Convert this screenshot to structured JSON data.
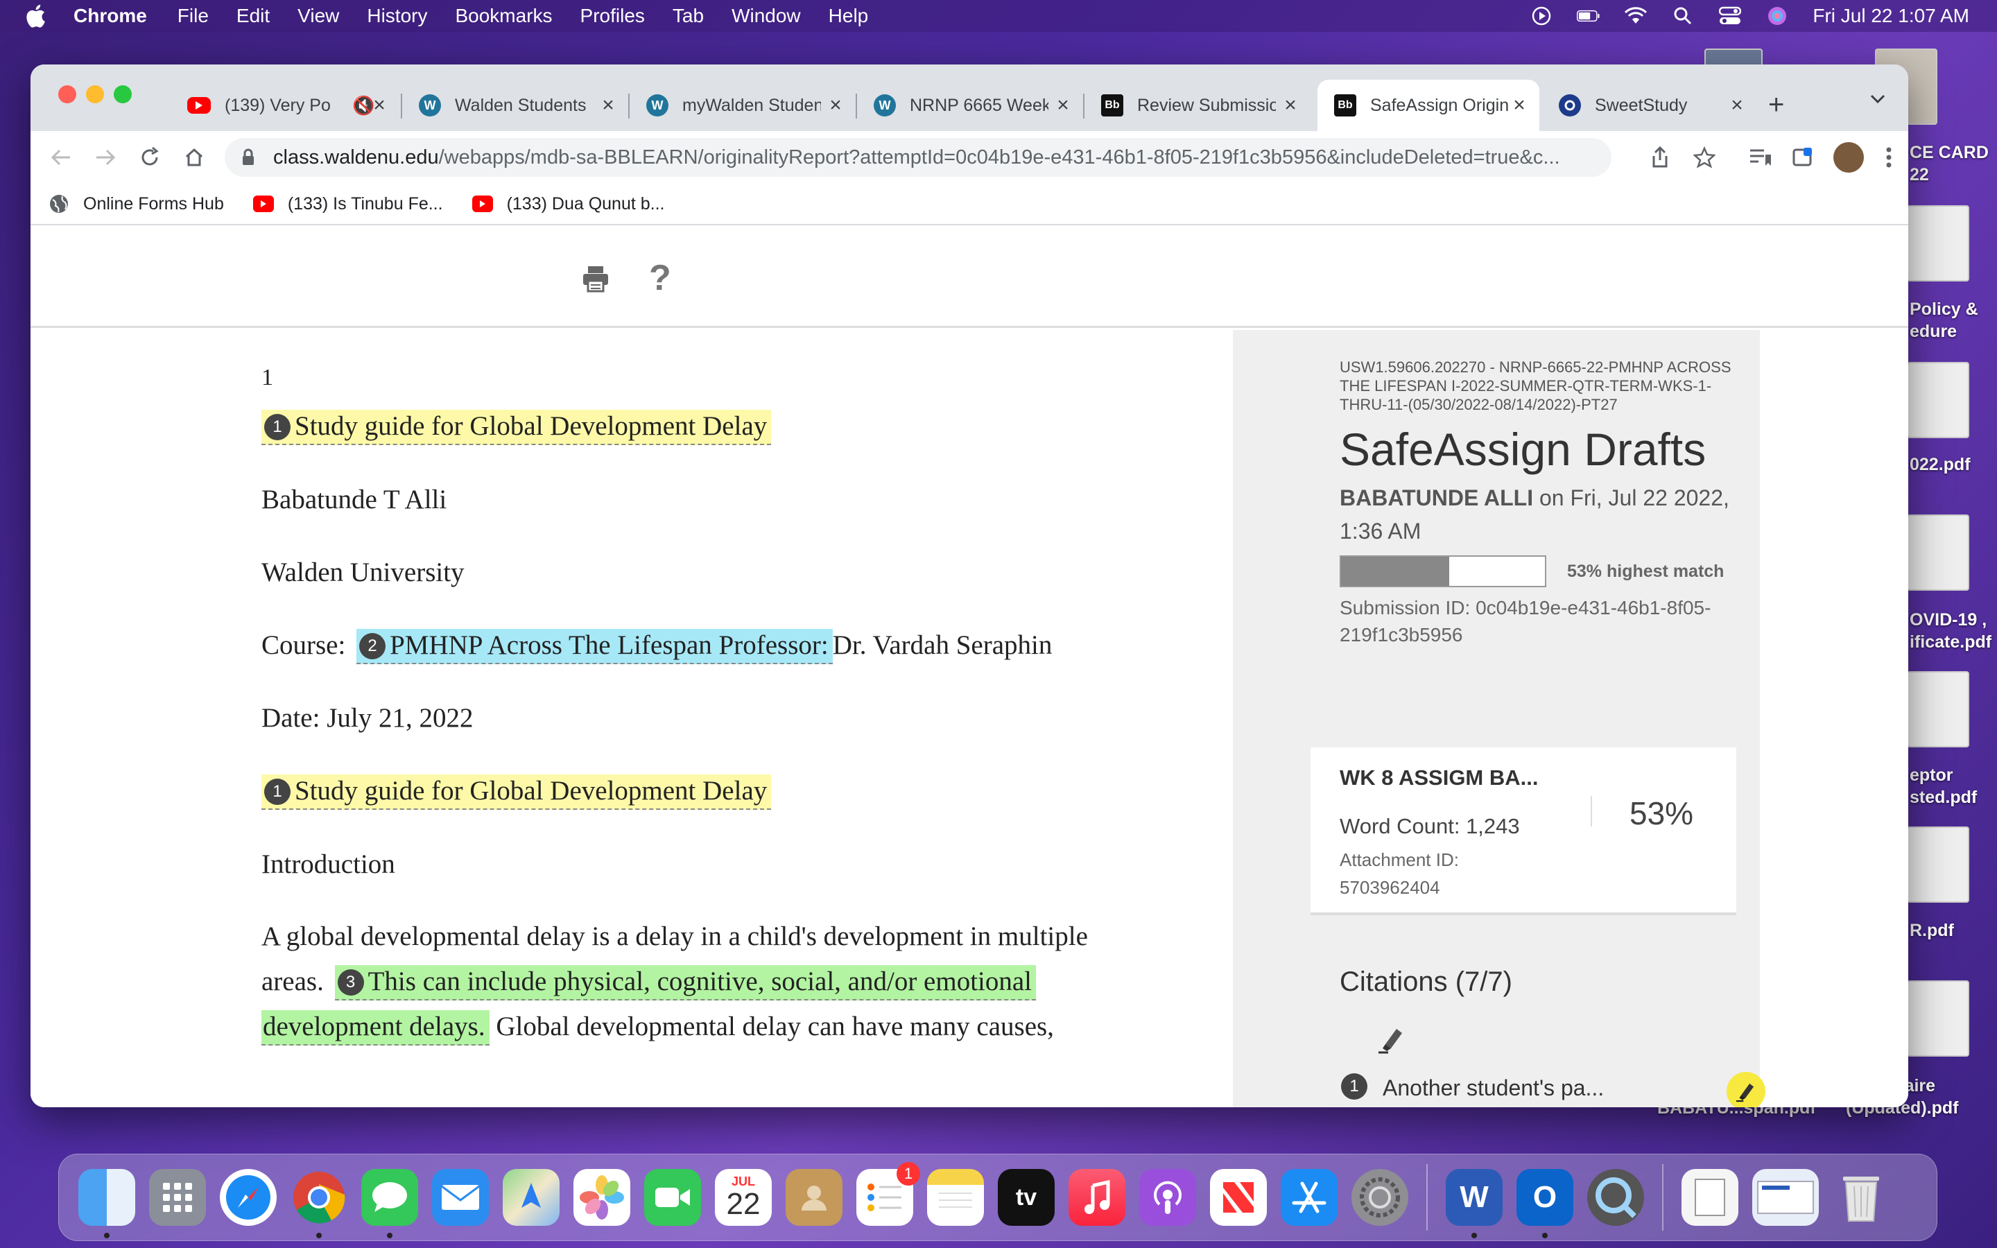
{
  "menubar": {
    "app_name": "Chrome",
    "items": [
      "File",
      "Edit",
      "View",
      "History",
      "Bookmarks",
      "Profiles",
      "Tab",
      "Window",
      "Help"
    ],
    "clock": "Fri Jul 22  1:07 AM"
  },
  "desktop": {
    "labels": [
      "CE CARD",
      "22",
      "Policy &",
      "edure",
      "022.pdf",
      "OVID-19 ,",
      "ificate.pdf",
      "eptor",
      "sted.pdf",
      "R.pdf",
      "ssionnaire",
      "(Updated).pdf",
      "BABATU...span.pdf"
    ]
  },
  "browser": {
    "tabs": [
      {
        "title": "(139) Very Po",
        "favicon": "youtube-icon",
        "color": "#ff0000"
      },
      {
        "title": "Walden Students",
        "favicon": "wordpress-icon",
        "color": "#21759b"
      },
      {
        "title": "myWalden Studen",
        "favicon": "wordpress-icon",
        "color": "#21759b"
      },
      {
        "title": "NRNP 6665 Week",
        "favicon": "wordpress-icon",
        "color": "#21759b"
      },
      {
        "title": "Review Submissio",
        "favicon": "blackboard-icon",
        "color": "#111111"
      },
      {
        "title": "SafeAssign Origin",
        "favicon": "blackboard-icon",
        "color": "#111111"
      },
      {
        "title": "SweetStudy",
        "favicon": "sweetstudy-icon",
        "color": "#1e3a8a"
      }
    ],
    "url_domain": "class.waldenu.edu",
    "url_path": "/webapps/mdb-sa-BBLEARN/originalityReport?attemptId=0c04b19e-e431-46b1-8f05-219f1c3b5956&includeDeleted=true&c...",
    "bookmarks": [
      {
        "label": "Online Forms Hub",
        "icon": "globe-icon"
      },
      {
        "label": "(133) Is Tinubu Fe...",
        "icon": "youtube-icon"
      },
      {
        "label": "(133) Dua Qunut b...",
        "icon": "youtube-icon"
      }
    ]
  },
  "document": {
    "page_number": "1",
    "title_1": "Study guide for Global Development Delay",
    "author": "Babatunde T Alli",
    "institution": "Walden University",
    "course_label": "Course:",
    "course_highlight": "PMHNP Across The Lifespan Professor:",
    "course_rest": "Dr. Vardah Seraphin",
    "date": "Date: July 21, 2022",
    "title_2": "Study guide for Global Development Delay",
    "intro_heading": "Introduction",
    "para_line1": "A global developmental delay is a delay in a child's development in multiple",
    "para_line2_start": "areas.",
    "para_hl_a": "This can include physical, cognitive, social, and/or emotional",
    "para_hl_b": "development delays.",
    "para_line3_rest": " Global developmental delay can have many causes,",
    "match_numbers": [
      "1",
      "2",
      "1",
      "3"
    ]
  },
  "safeassign": {
    "course_code": "USW1.59606.202270 - NRNP-6665-22-PMHNP ACROSS THE LIFESPAN I-2022-SUMMER-QTR-TERM-WKS-1-THRU-11-(05/30/2022-08/14/2022)-PT27",
    "title": "SafeAssign Drafts",
    "student": "BABATUNDE ALLI",
    "submitted": " on Fri, Jul 22 2022, 1:36 AM",
    "highest_match": 0.53,
    "highest_match_label": "53% highest match",
    "submission_id": "Submission ID: 0c04b19e-e431-46b1-8f05-219f1c3b5956",
    "attachment": {
      "title": "WK 8 ASSIGM BA...",
      "word_count": "Word Count: 1,243",
      "attachment_id": "Attachment ID: 5703962404",
      "match_percent": "53%"
    },
    "citations_title": "Citations (7/7)",
    "citations": [
      {
        "number": "1",
        "label": "Another student's pa..."
      }
    ]
  },
  "dock": {
    "calendar_month": "JUL",
    "calendar_day": "22",
    "reminders_badge": "1",
    "tv_label": "tv"
  }
}
